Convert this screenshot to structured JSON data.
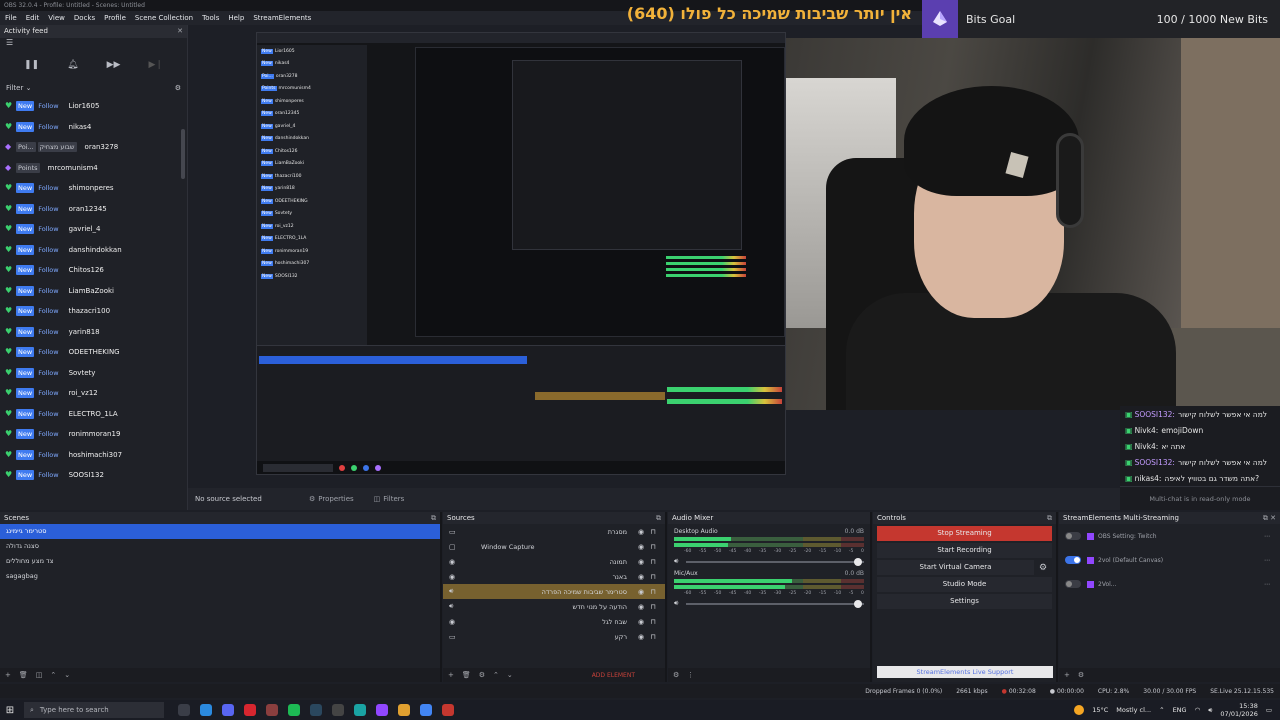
{
  "window": {
    "title": "OBS 32.0.4 - Profile: Untitled - Scenes: Untitled"
  },
  "menu": [
    "File",
    "Edit",
    "View",
    "Docks",
    "Profile",
    "Scene Collection",
    "Tools",
    "Help",
    "StreamElements"
  ],
  "overlay": {
    "banner_text": "(640) אין יותר שביבות שמיכה כל פולו",
    "bits_goal_label": "Bits Goal",
    "bits_goal_progress": "100 / 1000 New Bits"
  },
  "activity_feed": {
    "title": "Activity feed",
    "filter_label": "Filter",
    "items": [
      {
        "type": "follow",
        "badge": "New",
        "kind": "Follow",
        "name": "Lior1605"
      },
      {
        "type": "follow",
        "badge": "New",
        "kind": "Follow",
        "name": "nikas4"
      },
      {
        "type": "points",
        "badge": "Poi...",
        "kind": "שבוע מצחיק",
        "name": "oran3278"
      },
      {
        "type": "points",
        "badge": "Points",
        "kind": "",
        "name": "mrcomunism4"
      },
      {
        "type": "follow",
        "badge": "New",
        "kind": "Follow",
        "name": "shimonperes"
      },
      {
        "type": "follow",
        "badge": "New",
        "kind": "Follow",
        "name": "oran12345"
      },
      {
        "type": "follow",
        "badge": "New",
        "kind": "Follow",
        "name": "gavriel_4"
      },
      {
        "type": "follow",
        "badge": "New",
        "kind": "Follow",
        "name": "danshindokkan"
      },
      {
        "type": "follow",
        "badge": "New",
        "kind": "Follow",
        "name": "Chitos126"
      },
      {
        "type": "follow",
        "badge": "New",
        "kind": "Follow",
        "name": "LiamBaZooki"
      },
      {
        "type": "follow",
        "badge": "New",
        "kind": "Follow",
        "name": "thazacri100"
      },
      {
        "type": "follow",
        "badge": "New",
        "kind": "Follow",
        "name": "yarin818"
      },
      {
        "type": "follow",
        "badge": "New",
        "kind": "Follow",
        "name": "ODEETHEKING"
      },
      {
        "type": "follow",
        "badge": "New",
        "kind": "Follow",
        "name": "Sovtety"
      },
      {
        "type": "follow",
        "badge": "New",
        "kind": "Follow",
        "name": "roi_vz12"
      },
      {
        "type": "follow",
        "badge": "New",
        "kind": "Follow",
        "name": "ELECTRO_1LA"
      },
      {
        "type": "follow",
        "badge": "New",
        "kind": "Follow",
        "name": "ronimmoran19"
      },
      {
        "type": "follow",
        "badge": "New",
        "kind": "Follow",
        "name": "hoshimachi307"
      },
      {
        "type": "follow",
        "badge": "New",
        "kind": "Follow",
        "name": "SOOSI132"
      }
    ]
  },
  "chat": {
    "messages": [
      {
        "user": "SOOSI132:",
        "text": "למה אי אפשר לשלוח קישור",
        "purple": true
      },
      {
        "user": "Nivk4:",
        "text": "emojiDown",
        "purple": false
      },
      {
        "user": "Nivk4:",
        "text": "אתה יא",
        "purple": false
      },
      {
        "user": "SOOSI132:",
        "text": "למה אי אפשר לשלוח קישור",
        "purple": true
      },
      {
        "user": "nikas4:",
        "text": "אתה משדר גם בטוויץ לאיפה?",
        "purple": false
      }
    ],
    "readonly_note": "Multi-chat is in read-only mode"
  },
  "preview": {
    "no_source": "No source selected",
    "properties_label": "Properties",
    "filters_label": "Filters"
  },
  "scenes": {
    "title": "Scenes",
    "items": [
      "סטרימר גיימינג",
      "סצנה גדולה",
      "צד מצע מחוללים",
      "sagagbag"
    ],
    "selected_index": 0
  },
  "sources": {
    "title": "Sources",
    "items": [
      {
        "name": "מסגרת",
        "icon": "monitor"
      },
      {
        "name": "Window Capture",
        "icon": "window"
      },
      {
        "name": "תמונה",
        "icon": "image"
      },
      {
        "name": "באנר",
        "icon": "image"
      },
      {
        "name": "סטרימר שביבות שמיכה הפרדה",
        "icon": "audio"
      },
      {
        "name": "הודעה על מנוי חדש",
        "icon": "audio"
      },
      {
        "name": "שבח לגל",
        "icon": "image"
      },
      {
        "name": "רקע",
        "icon": "monitor"
      }
    ],
    "selected_index": 4,
    "add_element": "ADD ELEMENT"
  },
  "audio_mixer": {
    "title": "Audio Mixer",
    "tracks": [
      {
        "name": "Desktop Audio",
        "db": "0.0 dB",
        "level": 0.3,
        "fader": 0.99
      },
      {
        "name": "Mic/Aux",
        "db": "0.0 dB",
        "level": 0.62,
        "fader": 0.99
      }
    ],
    "ticks": [
      "-60",
      "-55",
      "-50",
      "-45",
      "-40",
      "-35",
      "-30",
      "-25",
      "-20",
      "-15",
      "-10",
      "-5",
      "0"
    ]
  },
  "controls": {
    "title": "Controls",
    "stop_streaming": "Stop Streaming",
    "start_recording": "Start Recording",
    "start_virtual_camera": "Start Virtual Camera",
    "studio_mode": "Studio Mode",
    "settings": "Settings",
    "live_support": "StreamElements Live Support"
  },
  "multistream": {
    "title": "StreamElements Multi-Streaming",
    "rows": [
      {
        "label": "OBS Setting: Twitch",
        "enabled": false
      },
      {
        "label": "2vol (Default Canvas)",
        "enabled": true
      },
      {
        "label": "2Vol...",
        "enabled": false
      }
    ]
  },
  "status": {
    "dropped": "Dropped Frames 0 (0.0%)",
    "bitrate": "2661 kbps",
    "live_time": "00:32:08",
    "rec_time": "00:00:00",
    "cpu": "CPU: 2.8%",
    "fps": "30.00 / 30.00 FPS",
    "version": "SE.Live 25.12.15.535"
  },
  "taskbar": {
    "search_placeholder": "Type here to search",
    "weather": "15°C",
    "weather_desc": "Mostly cl...",
    "lang": "ENG",
    "time": "15:38",
    "date": "07/01/2026"
  },
  "colors": {
    "accent_blue": "#2b5fd9",
    "stop_red": "#c5372f",
    "follow_green": "#3bd16f",
    "bits_purple": "#5b3fb0",
    "banner_gold": "#f2b23a"
  }
}
